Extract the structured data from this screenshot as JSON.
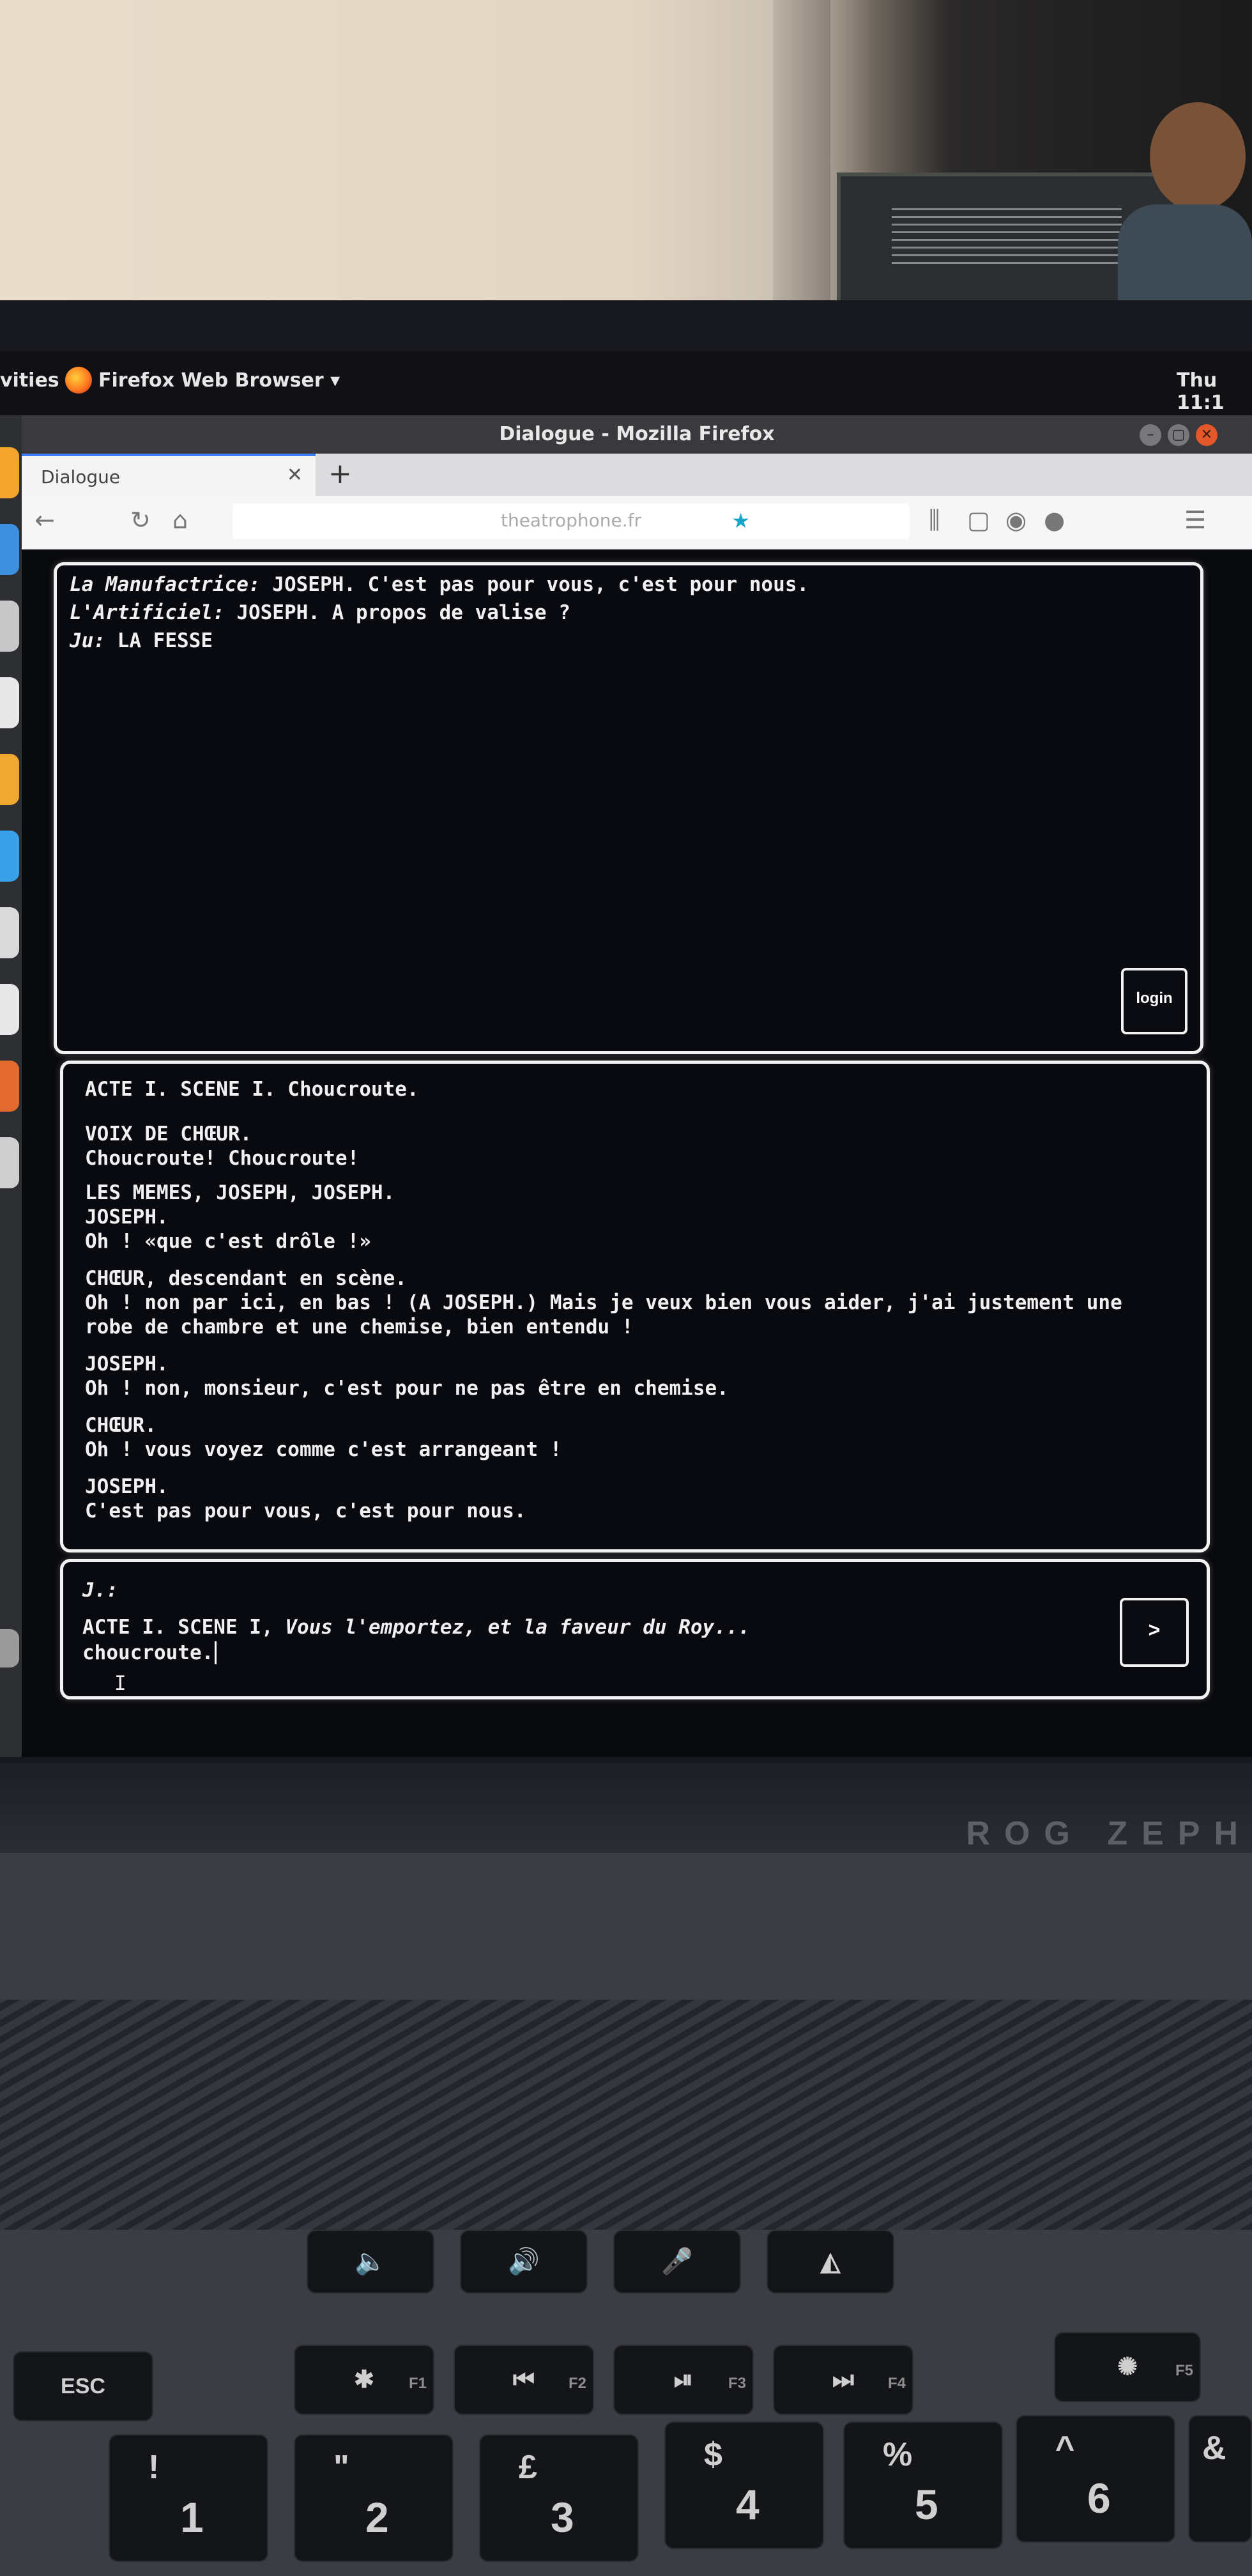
{
  "topbar": {
    "activities": "vities",
    "app_menu": "Firefox Web Browser ▾",
    "clock": "Thu 11:1"
  },
  "window": {
    "title": "Dialogue - Mozilla Firefox"
  },
  "browser": {
    "tab_label": "Dialogue",
    "url": "theatrophone.fr"
  },
  "dialogue_panel": {
    "lines": [
      {
        "speaker": "La Manufactrice:",
        "text": "JOSEPH. C'est pas pour vous, c'est pour nous."
      },
      {
        "speaker": "L'Artificiel:",
        "text": "JOSEPH. A propos de valise ?"
      },
      {
        "speaker": "Ju:",
        "text": "LA FESSE"
      }
    ],
    "login_label": "login"
  },
  "script_panel": {
    "lines": [
      "ACTE I. SCENE I. Choucroute.",
      "VOIX DE CHŒUR.",
      "Choucroute! Choucroute!",
      "LES MEMES, JOSEPH, JOSEPH.",
      "JOSEPH.",
      "Oh ! «que c'est drôle !»",
      "CHŒUR, descendant en scène.",
      "Oh ! non par ici, en bas ! (A JOSEPH.) Mais je veux bien vous aider, j'ai justement une",
      "robe de chambre et une chemise, bien entendu !",
      "JOSEPH.",
      "Oh ! non, monsieur, c'est pour ne pas être en chemise.",
      "CHŒUR.",
      "Oh ! vous voyez comme c'est arrangeant !",
      "JOSEPH.",
      "C'est pas pour vous, c'est pour nous."
    ]
  },
  "input_panel": {
    "label": "J.:",
    "line1_prefix": "ACTE I. SCENE I,",
    "line1_rest": "Vous l'emportez, et la faveur du Roy...",
    "line2": "choucroute.",
    "send_label": ">"
  },
  "laptop": {
    "brand": "ROG ZEPH"
  },
  "keyboard": {
    "esc": "ESC",
    "f_keys": [
      "F1",
      "F2",
      "F3",
      "F4",
      "F5"
    ],
    "numbers": [
      "!",
      "1",
      "\"",
      "2",
      "£",
      "3",
      "$",
      "4",
      "%",
      "5",
      "^",
      "6",
      "&"
    ]
  },
  "colors": {
    "page_bg": "#08090d",
    "panel_border": "#f2f2f2",
    "text": "#f0f0f0",
    "url_star": "#16a3c4"
  }
}
